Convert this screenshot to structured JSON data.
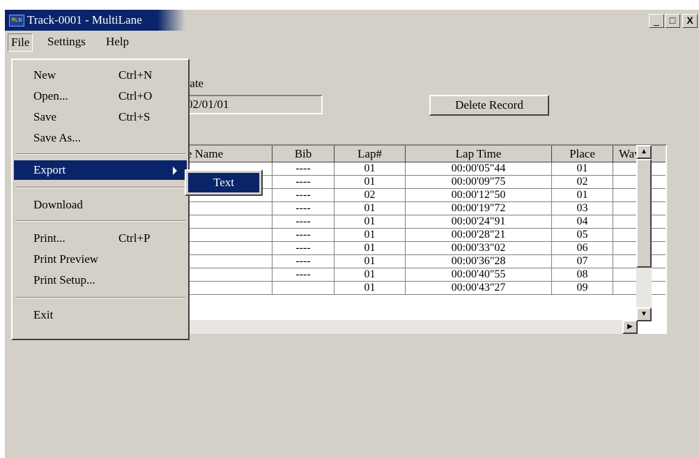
{
  "window": {
    "title": "Track-0001 - MultiLane",
    "app_icon_text": "MLN",
    "controls": {
      "minimize": "_",
      "maximize": "□",
      "close": "X"
    }
  },
  "menubar": {
    "items": [
      {
        "label": "File"
      },
      {
        "label": "Settings"
      },
      {
        "label": "Help"
      }
    ]
  },
  "form": {
    "date_label": "Date",
    "date_value": "02/01/01",
    "delete_button": "Delete Record"
  },
  "table": {
    "columns": [
      "te Name",
      "Bib",
      "Lap#",
      "Lap Time",
      "Place",
      "Wave#"
    ],
    "rows": [
      {
        "bib": "----",
        "lap": "01",
        "time": "00:00'05\"44",
        "place": "01"
      },
      {
        "bib": "----",
        "lap": "01",
        "time": "00:00'09\"75",
        "place": "02"
      },
      {
        "bib": "----",
        "lap": "02",
        "time": "00:00'12\"50",
        "place": "01"
      },
      {
        "bib": "----",
        "lap": "01",
        "time": "00:00'19\"72",
        "place": "03"
      },
      {
        "bib": "----",
        "lap": "01",
        "time": "00:00'24\"91",
        "place": "04"
      },
      {
        "bib": "----",
        "lap": "01",
        "time": "00:00'28\"21",
        "place": "05"
      },
      {
        "bib": "----",
        "lap": "01",
        "time": "00:00'33\"02",
        "place": "06"
      },
      {
        "bib": "----",
        "lap": "01",
        "time": "00:00'36\"28",
        "place": "07"
      },
      {
        "bib": "----",
        "lap": "01",
        "time": "00:00'40\"55",
        "place": "08"
      },
      {
        "bib": "",
        "lap": "01",
        "time": "00:00'43\"27",
        "place": "09"
      }
    ]
  },
  "scrollbar": {
    "up": "▲",
    "down": "▼",
    "right": "▶"
  },
  "file_menu": {
    "new": {
      "label": "New",
      "shortcut": "Ctrl+N"
    },
    "open": {
      "label": "Open...",
      "shortcut": "Ctrl+O"
    },
    "save": {
      "label": "Save",
      "shortcut": "Ctrl+S"
    },
    "save_as": {
      "label": "Save As..."
    },
    "export": {
      "label": "Export"
    },
    "download": {
      "label": "Download"
    },
    "print": {
      "label": "Print...",
      "shortcut": "Ctrl+P"
    },
    "print_preview": {
      "label": "Print Preview"
    },
    "print_setup": {
      "label": "Print Setup..."
    },
    "exit": {
      "label": "Exit"
    }
  },
  "export_submenu": {
    "text": "Text"
  }
}
